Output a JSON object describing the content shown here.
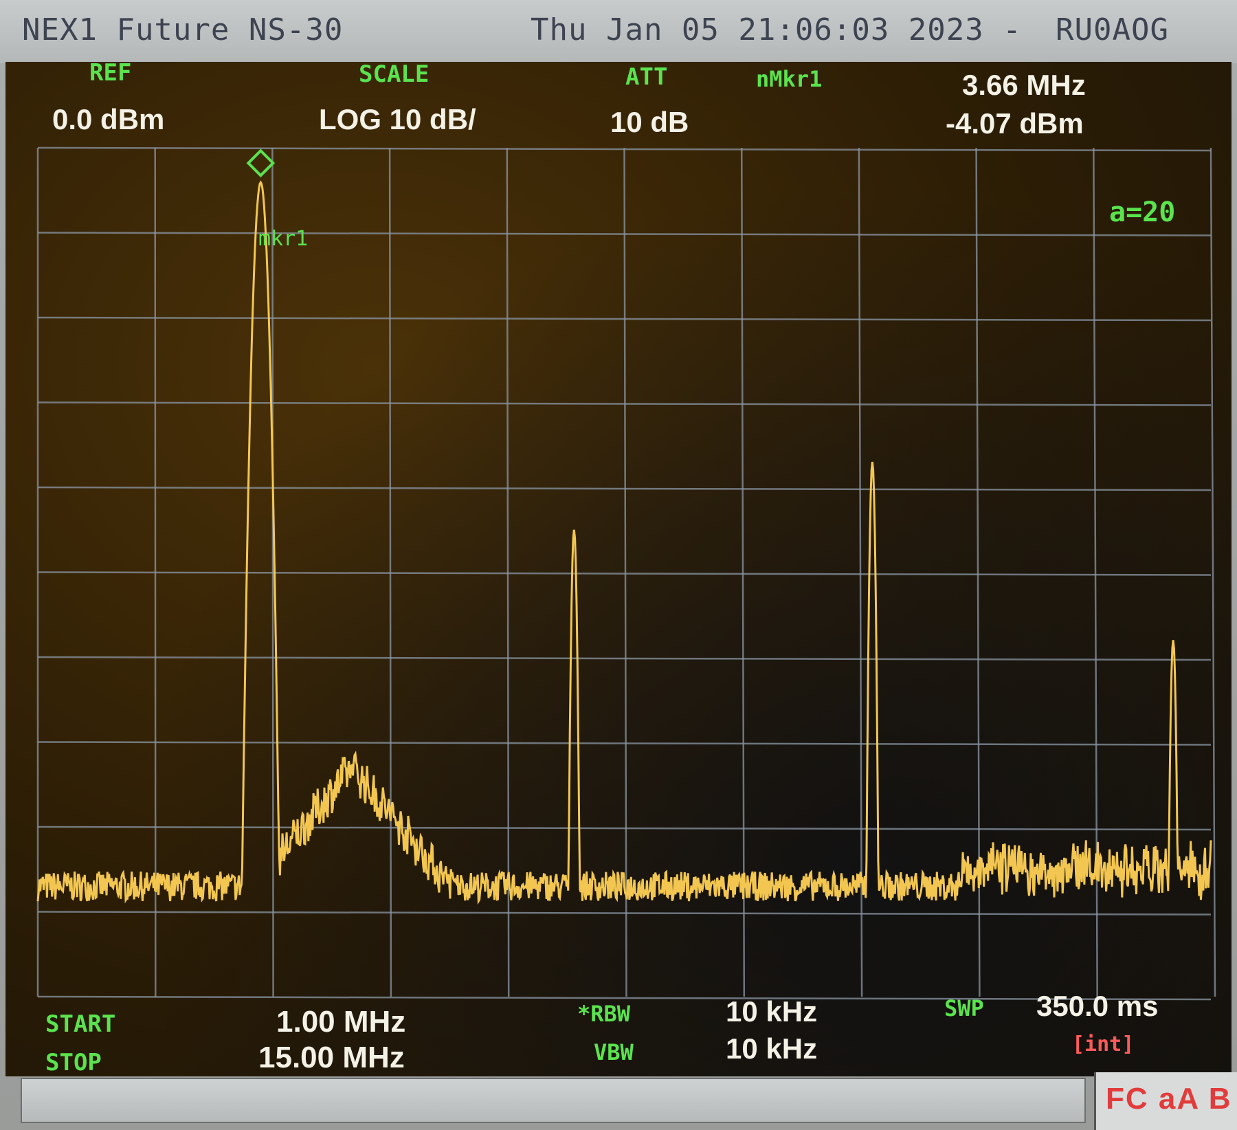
{
  "title_bar": {
    "instrument": "NEX1 Future NS-30",
    "datetime": "Thu Jan 05 21:06:03 2023 -",
    "callsign": "RU0AOG"
  },
  "header": {
    "ref_label": "REF",
    "ref_value": "0.0 dBm",
    "scale_label": "SCALE",
    "scale_value": "LOG 10 dB/",
    "att_label": "ATT",
    "att_value": "10 dB",
    "marker_label": "nMkr1",
    "marker_freq": "3.66 MHz",
    "marker_level": "-4.07 dBm",
    "avg_label": "a=20"
  },
  "marker_tag": "mkr1",
  "footer": {
    "start_label": "START",
    "start_value": "1.00 MHz",
    "stop_label": "STOP",
    "stop_value": "15.00 MHz",
    "rbw_label": "*RBW",
    "rbw_value": "10 kHz",
    "vbw_label": "VBW",
    "vbw_value": "10 kHz",
    "swp_label": "SWP",
    "swp_value": "350.0 ms",
    "swp_mode": "[int]"
  },
  "status_flags": "FC aA B",
  "colors": {
    "trace": "#f2c650",
    "label": "#5be34e",
    "grid": "#8a96a3",
    "marker": "#5be34e"
  },
  "chart_data": {
    "type": "line",
    "xlim": [
      1.0,
      15.0
    ],
    "ylim": [
      -100,
      0
    ],
    "grid": true,
    "x_divisions": 10,
    "y_divisions": 10,
    "marker": {
      "x": 3.66,
      "y": -4.07
    },
    "peaks": [
      {
        "x": 3.66,
        "y": -4.07
      },
      {
        "x": 4.75,
        "y": -73
      },
      {
        "x": 7.4,
        "y": -45
      },
      {
        "x": 10.96,
        "y": -37
      },
      {
        "x": 14.55,
        "y": -58
      }
    ],
    "noise_floor": -87
  }
}
